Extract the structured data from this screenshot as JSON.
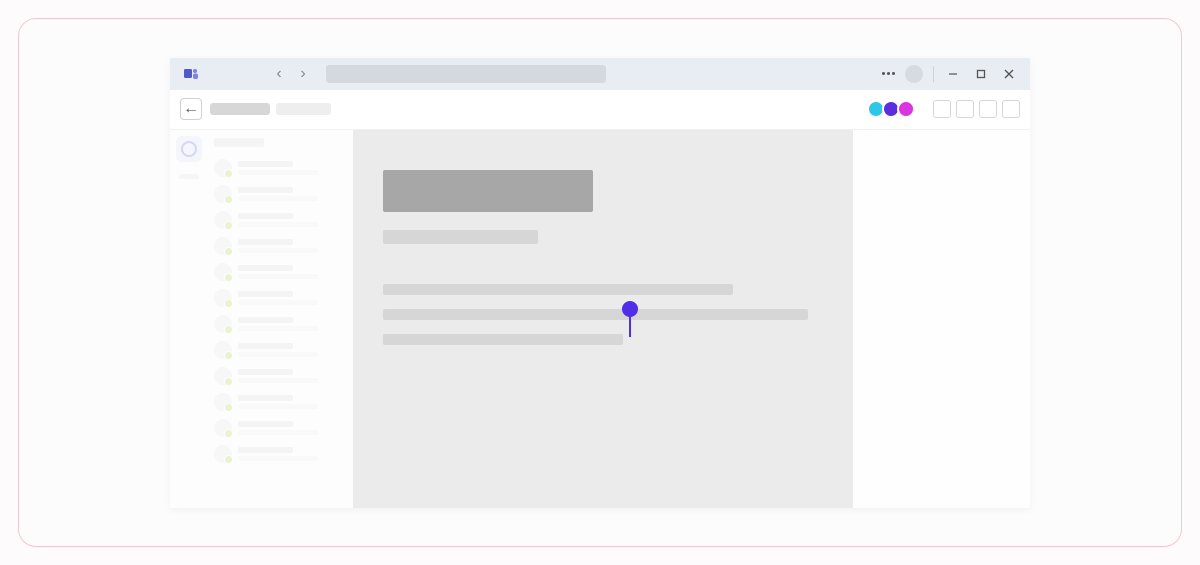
{
  "titlebar": {
    "nav_back_icon": "‹",
    "nav_fwd_icon": "›"
  },
  "subheader": {
    "back_icon": "←"
  },
  "presence": {
    "colors": [
      "#2ec7e6",
      "#5b2fe0",
      "#d936e0"
    ]
  },
  "collab_cursor": {
    "color": "#4f2ee8"
  }
}
